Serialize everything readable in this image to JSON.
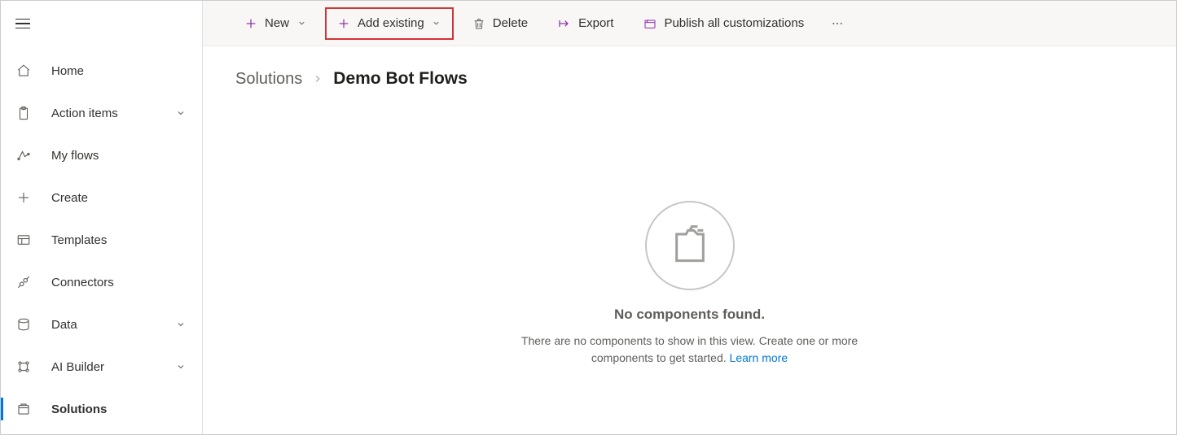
{
  "sidebar": {
    "items": [
      {
        "label": "Home",
        "expandable": false,
        "selected": false
      },
      {
        "label": "Action items",
        "expandable": true,
        "selected": false
      },
      {
        "label": "My flows",
        "expandable": false,
        "selected": false
      },
      {
        "label": "Create",
        "expandable": false,
        "selected": false
      },
      {
        "label": "Templates",
        "expandable": false,
        "selected": false
      },
      {
        "label": "Connectors",
        "expandable": false,
        "selected": false
      },
      {
        "label": "Data",
        "expandable": true,
        "selected": false
      },
      {
        "label": "AI Builder",
        "expandable": true,
        "selected": false
      },
      {
        "label": "Solutions",
        "expandable": false,
        "selected": true
      }
    ]
  },
  "toolbar": {
    "new_label": "New",
    "add_existing_label": "Add existing",
    "delete_label": "Delete",
    "export_label": "Export",
    "publish_label": "Publish all customizations"
  },
  "breadcrumb": {
    "parent": "Solutions",
    "current": "Demo Bot Flows"
  },
  "empty": {
    "title": "No components found.",
    "text": "There are no components to show in this view. Create one or more components to get started.",
    "link": "Learn more"
  }
}
